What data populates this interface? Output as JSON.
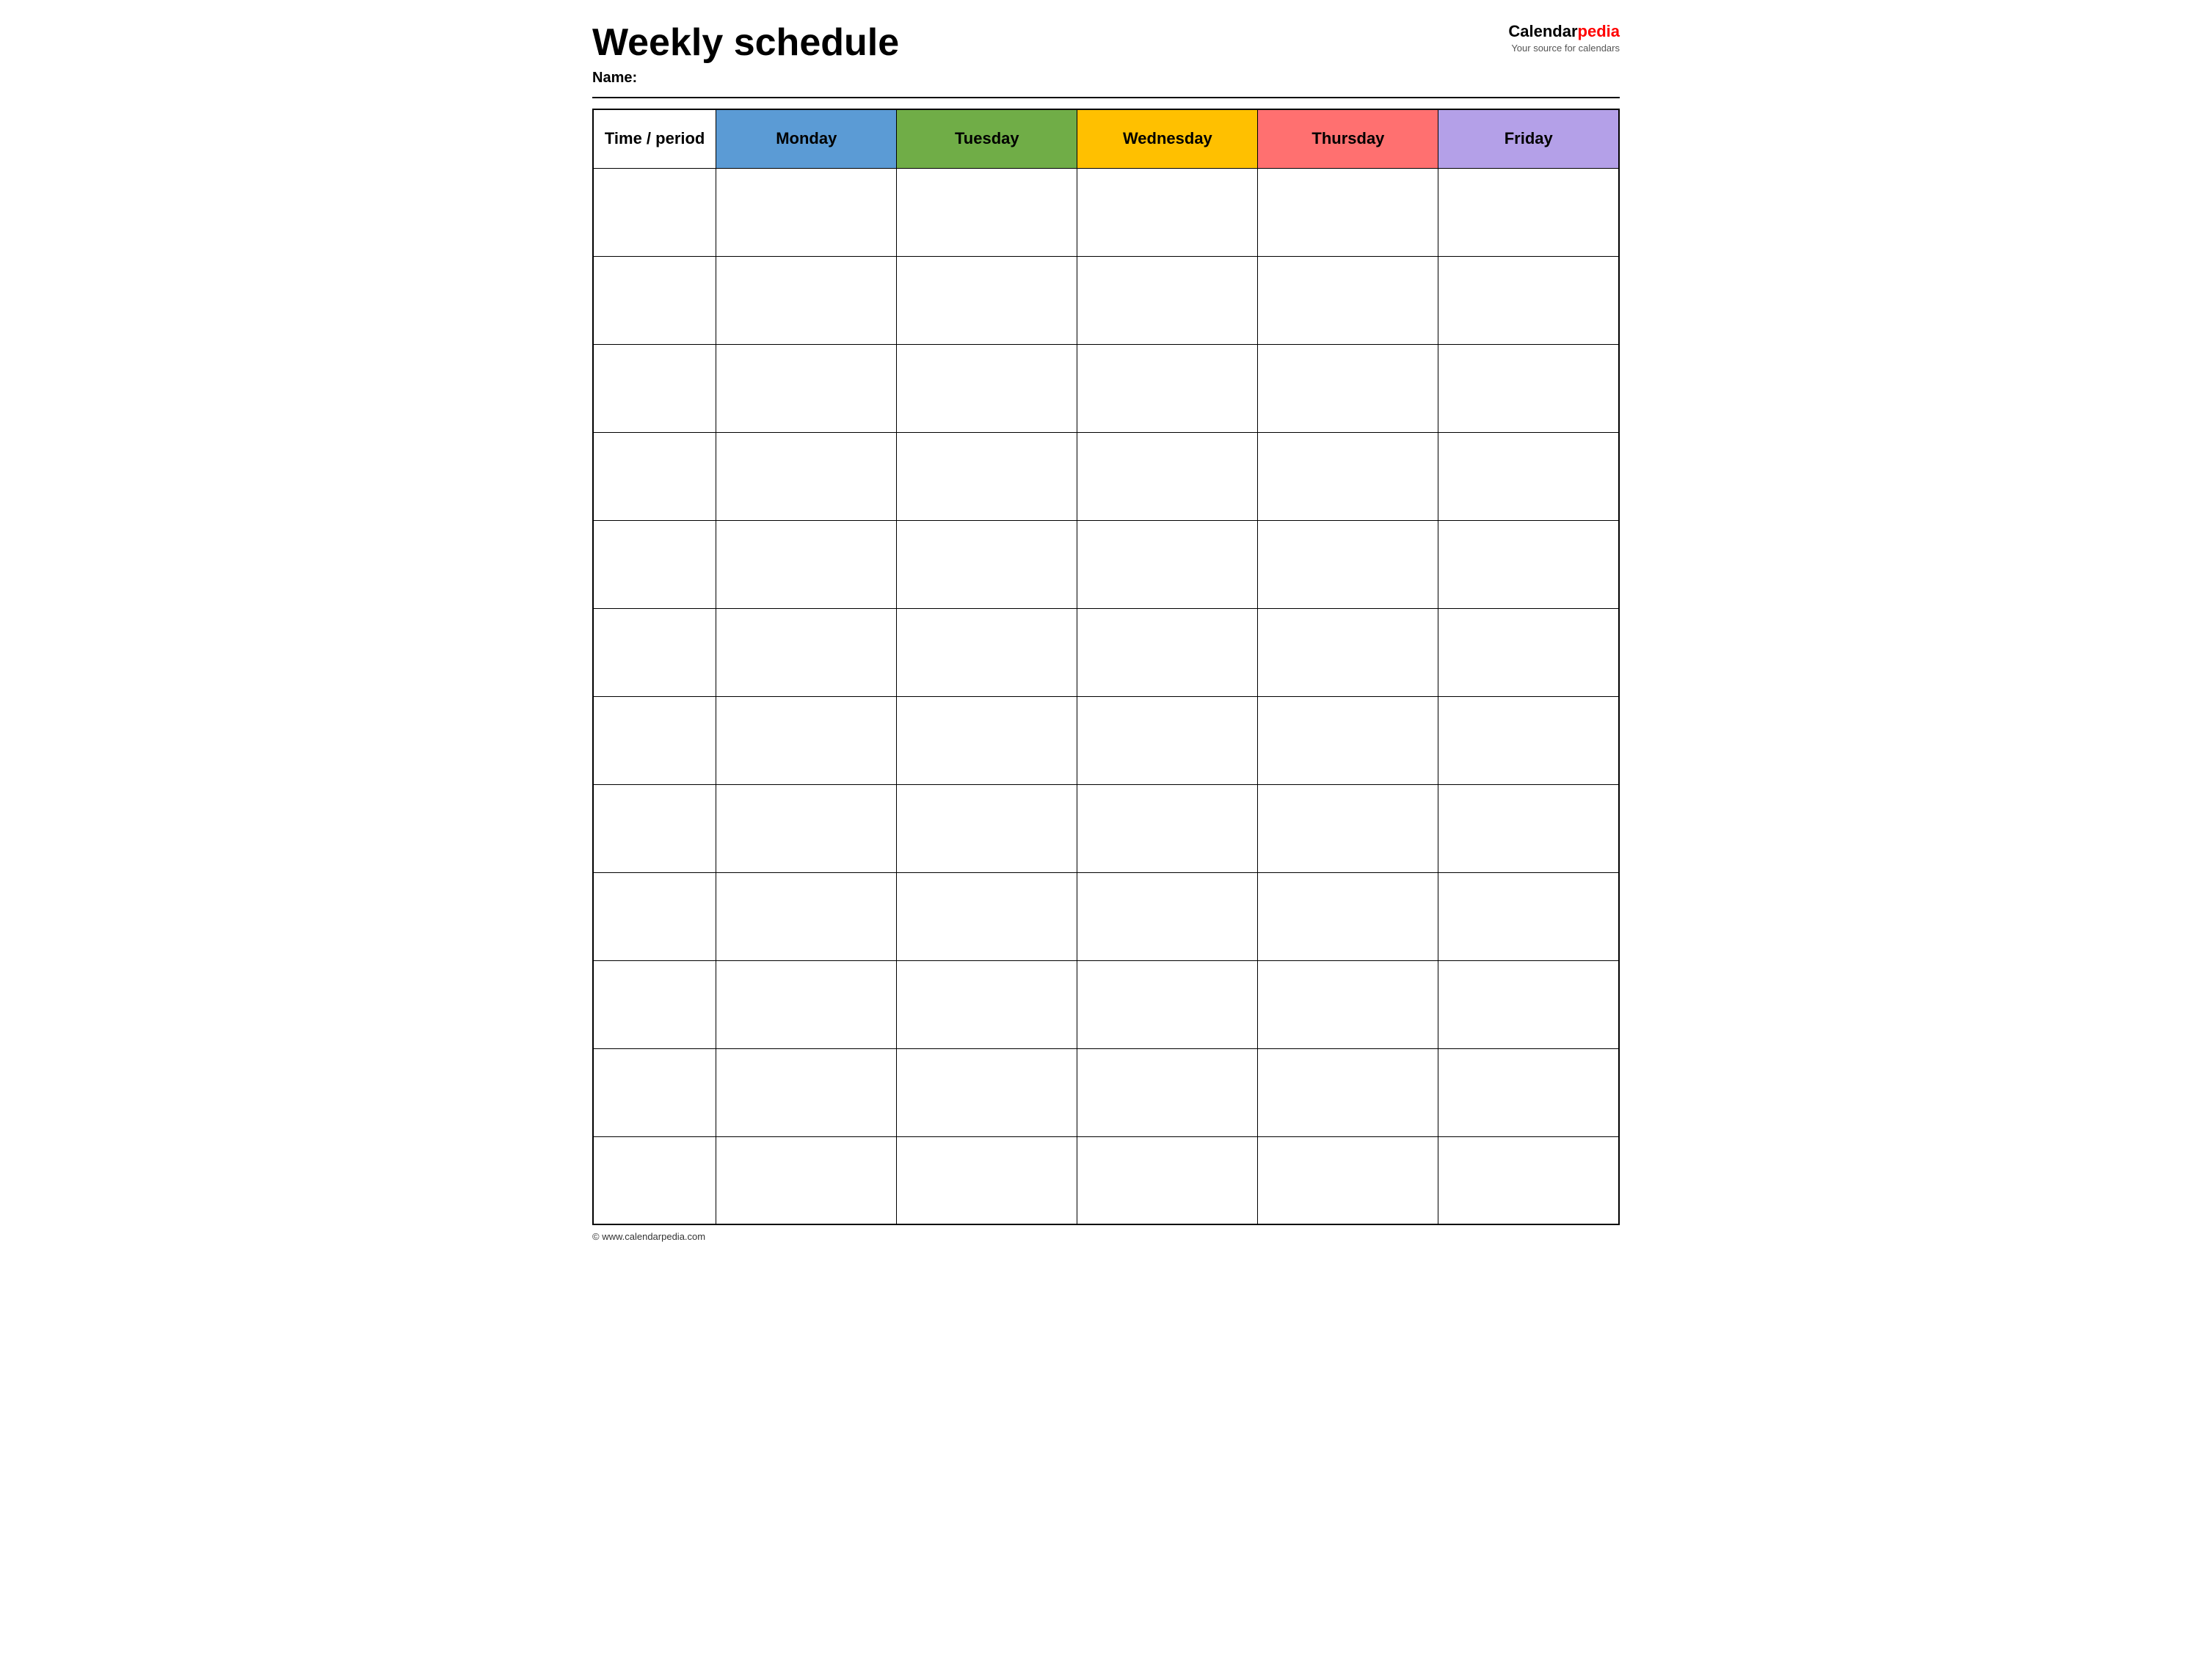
{
  "header": {
    "title": "Weekly schedule",
    "name_label": "Name:",
    "logo": {
      "calendar_part": "Calendar",
      "pedia_part": "pedia",
      "tagline": "Your source for calendars"
    }
  },
  "table": {
    "columns": [
      {
        "id": "time",
        "label": "Time / period",
        "color": "#ffffff"
      },
      {
        "id": "monday",
        "label": "Monday",
        "color": "#5b9bd5"
      },
      {
        "id": "tuesday",
        "label": "Tuesday",
        "color": "#70ad47"
      },
      {
        "id": "wednesday",
        "label": "Wednesday",
        "color": "#ffc000"
      },
      {
        "id": "thursday",
        "label": "Thursday",
        "color": "#ff7070"
      },
      {
        "id": "friday",
        "label": "Friday",
        "color": "#b4a0e8"
      }
    ],
    "row_count": 12
  },
  "footer": {
    "copyright": "© www.calendarpedia.com"
  }
}
